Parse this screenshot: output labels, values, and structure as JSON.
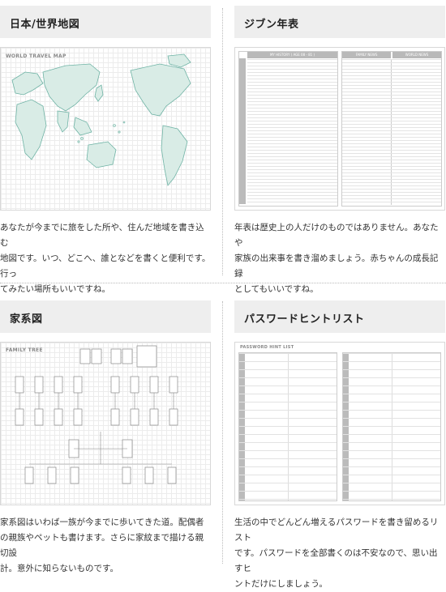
{
  "cards": [
    {
      "heading": "日本/世界地図",
      "thumb_title": "WORLD TRAVEL MAP",
      "desc_lines": [
        "あなたが今までに旅をした所や、住んだ地域を書き込む",
        "地図です。いつ、どこへ、誰となどを書くと便利です。行っ",
        "てみたい場所もいいですね。"
      ]
    },
    {
      "heading": "ジブン年表",
      "thumb_cols": [
        "MY HISTORY ( AGE 08 - 81 )",
        "FAMILY NEWS",
        "WORLD NEWS"
      ],
      "desc_lines": [
        "年表は歴史上の人だけのものではありません。あなたや",
        "家族の出来事を書き溜めましょう。赤ちゃんの成長記録",
        "としてもいいですね。"
      ]
    },
    {
      "heading": "家系図",
      "thumb_title": "FAMILY TREE",
      "desc_lines": [
        "家系図はいわば一族が今までに歩いてきた道。配偶者",
        "の親族やペットも書けます。さらに家紋まで描ける親切設",
        "計。意外に知らないものです。"
      ]
    },
    {
      "heading": "パスワードヒントリスト",
      "thumb_title": "PASSWORD HINT LIST",
      "desc_lines": [
        "生活の中でどんどん増えるパスワードを書き留めるリスト",
        "です。パスワードを全部書くのは不安なので、思い出すヒ",
        "ントだけにしましょう。"
      ]
    }
  ],
  "colors": {
    "heading_bg": "#eeeeee",
    "map_land": "#d9ece6",
    "map_border": "#6fb3a5",
    "table_header": "#b9b9b9"
  }
}
